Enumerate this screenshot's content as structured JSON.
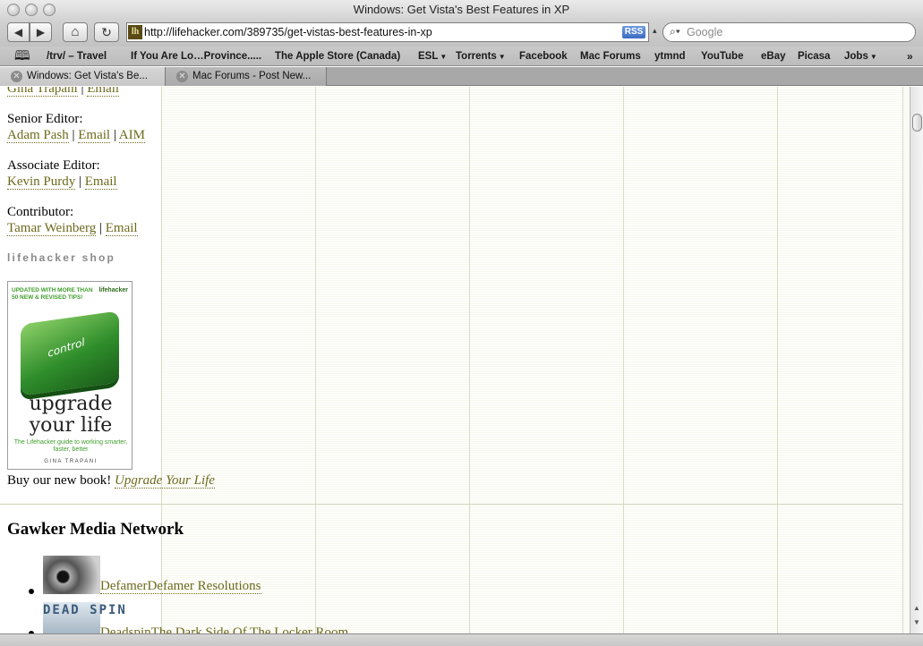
{
  "window": {
    "title": "Windows: Get Vista's Best Features in XP"
  },
  "toolbar": {
    "back_label": "◀",
    "forward_label": "▶",
    "home_label": "⌂",
    "reload_label": "↻",
    "url": "http://lifehacker.com/389735/get-vistas-best-features-in-xp",
    "favicon_text": "lh",
    "rss_label": "RSS",
    "search_placeholder": "Google"
  },
  "bookmarks": [
    {
      "label": "/trv/ – Travel"
    },
    {
      "label": "If You Are Lo…Province....."
    },
    {
      "label": "The Apple Store (Canada)"
    },
    {
      "label": "ESL",
      "menu": true
    },
    {
      "label": "Torrents",
      "menu": true
    },
    {
      "label": "Facebook"
    },
    {
      "label": "Mac Forums"
    },
    {
      "label": "ytmnd"
    },
    {
      "label": "YouTube"
    },
    {
      "label": "eBay"
    },
    {
      "label": "Picasa"
    },
    {
      "label": "Jobs",
      "menu": true
    }
  ],
  "tabs": [
    {
      "label": "Windows: Get Vista's Be...",
      "active": true
    },
    {
      "label": "Mac Forums - Post New...",
      "active": false
    }
  ],
  "staff": {
    "top_partial": {
      "name": "Gina Trapani",
      "sep": "|",
      "email": "Email"
    },
    "senior_editor": {
      "title": "Senior Editor:",
      "name": "Adam Pash",
      "email": "Email",
      "aim": "AIM"
    },
    "associate_editor": {
      "title": "Associate Editor:",
      "name": "Kevin Purdy",
      "email": "Email"
    },
    "contributor": {
      "title": "Contributor:",
      "name": "Tamar Weinberg",
      "email": "Email"
    },
    "separator": "|"
  },
  "shop": {
    "title": "lifehacker shop",
    "book_cover": {
      "tagline": "UPDATED WITH MORE THAN 50 NEW & REVISED TIPS!",
      "logo": "lifehacker",
      "key_label": "control",
      "title_line1": "upgrade",
      "title_line2": "your life",
      "subtitle": "The Lifehacker guide to working smarter, faster, better",
      "author": "GINA TRAPANI"
    },
    "promo_text": "Buy our new book!",
    "promo_link": "Upgrade Your Life"
  },
  "network": {
    "heading": "Gawker Media Network",
    "items": [
      {
        "text": "DefamerDefamer Resolutions",
        "thumb_text": ""
      },
      {
        "text": "DeadspinThe Dark Side Of The Locker Room",
        "thumb_text": "DEAD SPIN"
      }
    ]
  }
}
